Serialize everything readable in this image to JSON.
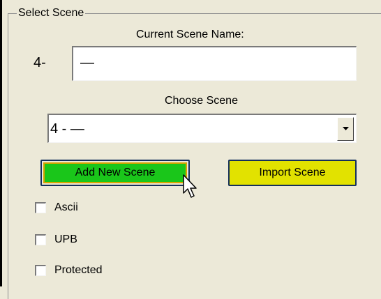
{
  "group": {
    "title": "Select Scene"
  },
  "current": {
    "label": "Current Scene Name:",
    "prefix": "4-",
    "value": "—"
  },
  "choose": {
    "label": "Choose Scene",
    "selected": "4 - —"
  },
  "buttons": {
    "add": "Add New Scene",
    "import": "Import Scene"
  },
  "checkboxes": [
    {
      "label": "Ascii",
      "checked": false
    },
    {
      "label": "UPB",
      "checked": false
    },
    {
      "label": "Protected",
      "checked": false
    }
  ],
  "colors": {
    "background": "#ece9d8",
    "add_button": "#1ac61a",
    "import_button": "#e2e200"
  }
}
